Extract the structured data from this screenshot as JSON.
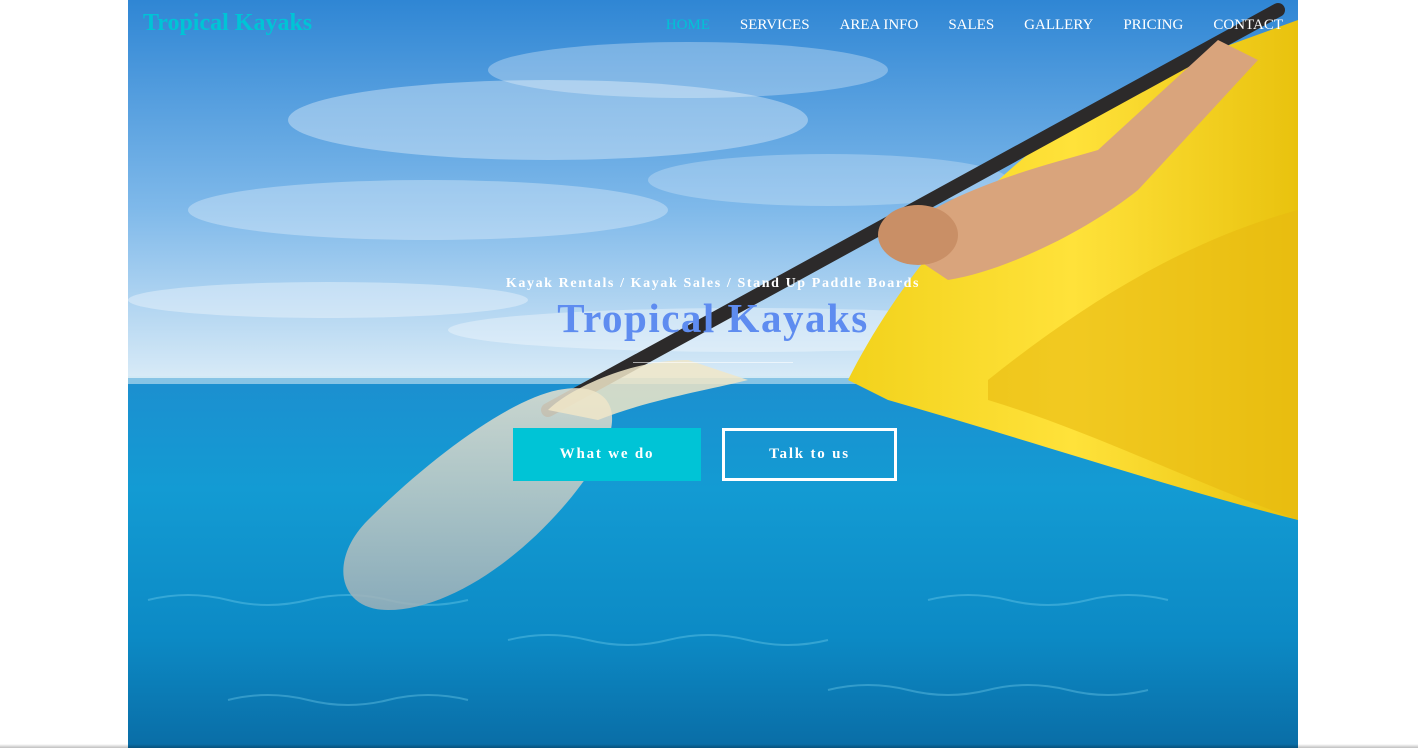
{
  "header": {
    "logo": "Tropical Kayaks",
    "nav": [
      {
        "label": "HOME",
        "active": true
      },
      {
        "label": "SERVICES",
        "active": false
      },
      {
        "label": "AREA INFO",
        "active": false
      },
      {
        "label": "SALES",
        "active": false
      },
      {
        "label": "GALLERY",
        "active": false
      },
      {
        "label": "PRICING",
        "active": false
      },
      {
        "label": "CONTACT",
        "active": false
      }
    ]
  },
  "hero": {
    "tagline": "Kayak Rentals / Kayak Sales / Stand Up Paddle Boards",
    "title": "Tropical Kayaks",
    "primary_button": "What we do",
    "secondary_button": "Talk to us",
    "background_image": "kayak-paddle-photo"
  },
  "colors": {
    "accent": "#00c4d6",
    "title": "#5e8cf0",
    "nav_text": "#ffffff"
  }
}
